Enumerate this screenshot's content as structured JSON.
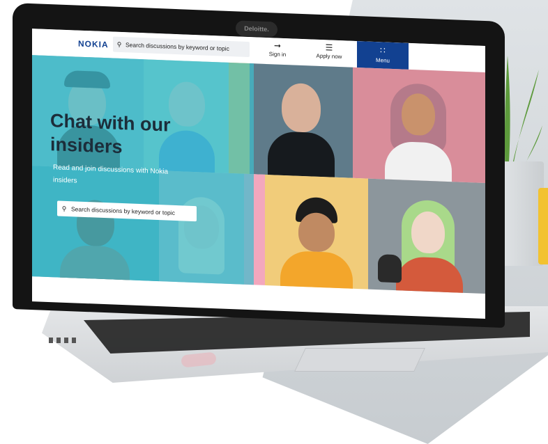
{
  "camera_brand": "Deloitte.",
  "site": {
    "logo": "NOKIA",
    "search_placeholder": "Search discussions by keyword or topic",
    "nav": {
      "sign_in": "Sign in",
      "apply_now": "Apply now",
      "menu": "Menu"
    },
    "hero": {
      "title": "Chat with our insiders",
      "subtitle": "Read and join discussions with Nokia insiders",
      "search_placeholder": "Search discussions by keyword or topic"
    }
  },
  "icons": {
    "search": "search-icon",
    "sign_in": "sign-in-icon",
    "apply": "apply-icon",
    "menu": "grid-menu-icon"
  },
  "colors": {
    "brand_blue": "#124191",
    "hero_overlay": "#40becd",
    "tile_yellow": "#f4c542",
    "tile_pink": "#f3a7bd",
    "tile_slate": "#5f7b8a"
  }
}
